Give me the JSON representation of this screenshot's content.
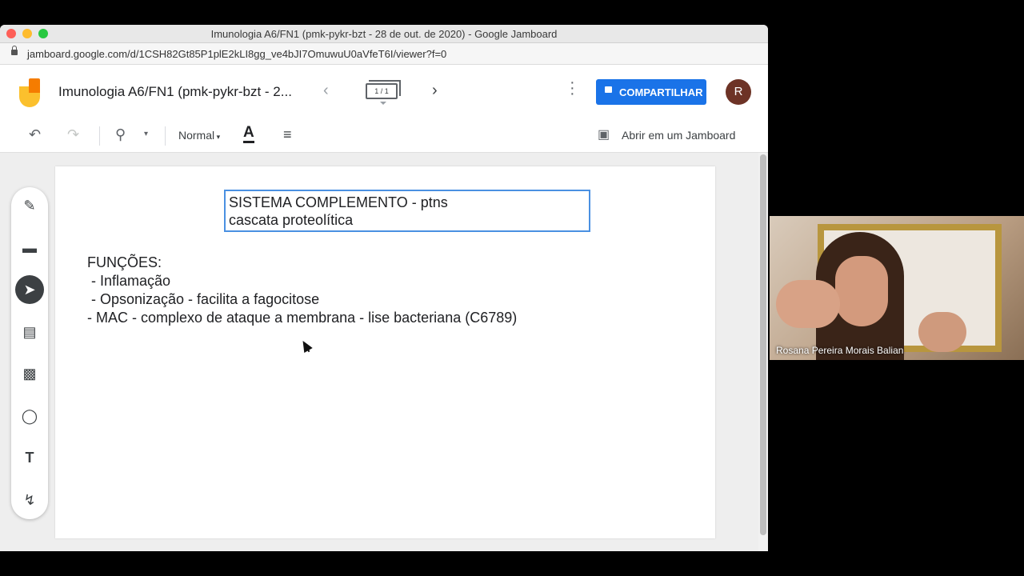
{
  "window": {
    "title": "Imunologia A6/FN1 (pmk-pykr-bzt - 28 de out. de 2020) - Google Jamboard",
    "url": "jamboard.google.com/d/1CSH82Gt85P1plE2kLI8gg_ve4bJI7OmuwuU0aVfeT6I/viewer?f=0"
  },
  "header": {
    "doc_title": "Imunologia A6/FN1 (pmk-pykr-bzt - 2...",
    "frame_indicator": "1 / 1",
    "share_label": "COMPARTILHAR",
    "avatar_initial": "R"
  },
  "toolbar": {
    "text_style": "Normal",
    "open_in_jamboard": "Abrir em um Jamboard"
  },
  "board": {
    "title_box": {
      "line1": "SISTEMA COMPLEMENTO - ptns",
      "line2": "cascata proteolítica"
    },
    "notes": [
      "FUNÇÕES:",
      " - Inflamação",
      " - Opsonização - facilita a fagocitose",
      "- MAC - complexo de ataque a membrana - lise bacteriana (C6789)"
    ]
  },
  "video": {
    "participant_name": "Rosana Pereira Morais Balian"
  },
  "colors": {
    "share_button": "#1a73e8",
    "avatar": "#6d3326",
    "selection": "#4a90e2"
  }
}
